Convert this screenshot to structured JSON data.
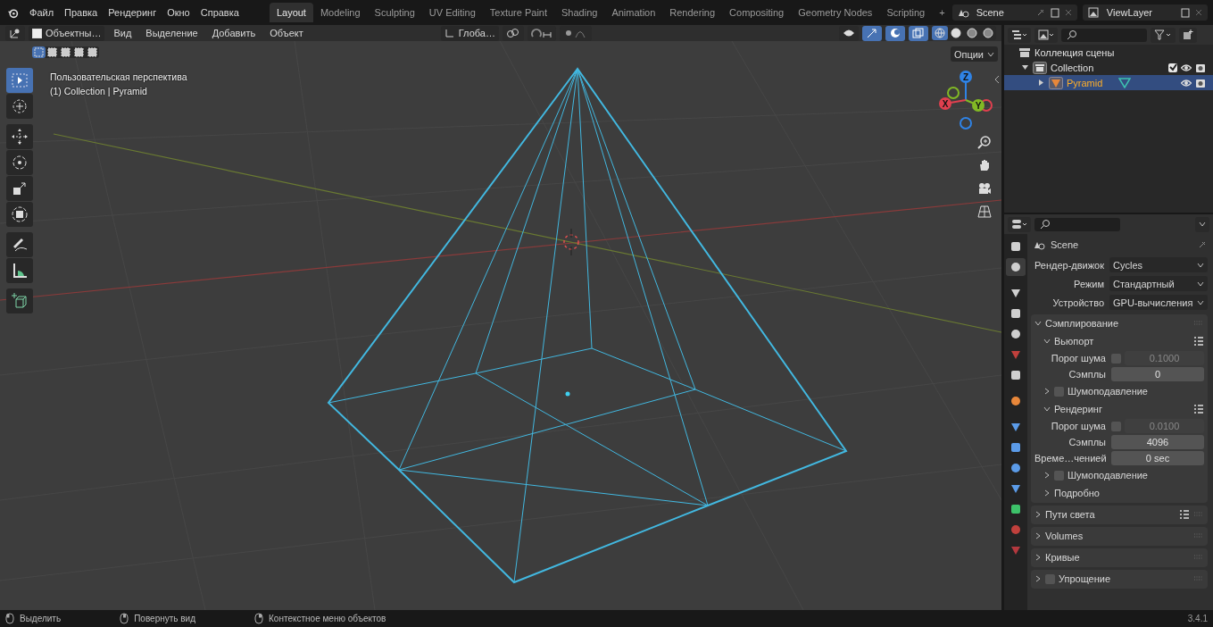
{
  "topbar": {
    "menus": [
      "Файл",
      "Правка",
      "Рендеринг",
      "Окно",
      "Справка"
    ],
    "workspaces": [
      {
        "label": "Layout",
        "selected": true
      },
      {
        "label": "Modeling",
        "selected": false
      },
      {
        "label": "Sculpting",
        "selected": false
      },
      {
        "label": "UV Editing",
        "selected": false
      },
      {
        "label": "Texture Paint",
        "selected": false
      },
      {
        "label": "Shading",
        "selected": false
      },
      {
        "label": "Animation",
        "selected": false
      },
      {
        "label": "Rendering",
        "selected": false
      },
      {
        "label": "Compositing",
        "selected": false
      },
      {
        "label": "Geometry Nodes",
        "selected": false
      },
      {
        "label": "Scripting",
        "selected": false
      }
    ],
    "add_tab": "+",
    "scene": "Scene",
    "view_layer": "ViewLayer"
  },
  "viewport": {
    "mode": "Объектны…",
    "menus": [
      "Вид",
      "Выделение",
      "Добавить",
      "Объект"
    ],
    "orientation": "Глоба…",
    "options": "Опции",
    "select_modes": [
      {
        "selected": true
      },
      {
        "selected": false
      },
      {
        "selected": false
      },
      {
        "selected": false
      },
      {
        "selected": false
      }
    ],
    "xray": true,
    "shading_modes": [
      {
        "selected": true
      },
      {
        "selected": false
      },
      {
        "selected": false
      },
      {
        "selected": false
      }
    ],
    "view_name": "Пользовательская перспектива",
    "object_info": "(1) Collection | Pyramid",
    "tools": [
      {
        "kind": "select",
        "selected": true
      },
      {
        "kind": "cursor",
        "selected": false
      },
      {
        "kind": "move",
        "selected": false
      },
      {
        "kind": "rotate",
        "selected": false
      },
      {
        "kind": "scale",
        "selected": false
      },
      {
        "kind": "transform",
        "selected": false
      },
      {
        "kind": "annotate",
        "selected": false
      },
      {
        "kind": "measure",
        "selected": false
      },
      {
        "kind": "add",
        "selected": false
      }
    ],
    "axes": [
      {
        "label": "Z",
        "color": "#2f83e6"
      },
      {
        "label": "X",
        "color": "#e0404f"
      },
      {
        "label": "Y",
        "color": "#82b925"
      }
    ]
  },
  "outliner": {
    "tree": [
      {
        "label": "Коллекция сцены",
        "children": [
          {
            "label": "Collection",
            "expanded": true,
            "checked": true,
            "selected": false,
            "children": [
              {
                "label": "Pyramid",
                "expanded": false,
                "selected": true
              }
            ]
          }
        ]
      }
    ]
  },
  "properties": {
    "tabs": [
      {
        "kind": "tool",
        "selected": false
      },
      {
        "kind": "render",
        "selected": true
      },
      {
        "kind": "output",
        "selected": false
      },
      {
        "kind": "view_layer",
        "selected": false
      },
      {
        "kind": "scene",
        "selected": false
      },
      {
        "kind": "world",
        "selected": false
      },
      {
        "kind": "collection",
        "selected": false
      },
      {
        "kind": "object",
        "selected": false
      },
      {
        "kind": "modifier",
        "selected": false
      },
      {
        "kind": "particles",
        "selected": false
      },
      {
        "kind": "physics",
        "selected": false
      },
      {
        "kind": "constraint",
        "selected": false
      },
      {
        "kind": "data",
        "selected": false
      },
      {
        "kind": "material",
        "selected": false
      },
      {
        "kind": "texture",
        "selected": false
      }
    ],
    "context": "Scene",
    "fields": [
      {
        "label": "Рендер-движок",
        "value": "Cycles"
      },
      {
        "label": "Режим",
        "value": "Стандартный"
      },
      {
        "label": "Устройство",
        "value": "GPU-вычисления"
      }
    ],
    "panels": [
      {
        "title": "Сэмплирование",
        "expanded": true,
        "children": [
          {
            "title": "Вьюпорт",
            "expanded": true,
            "rows": [
              {
                "label": "Порог шума",
                "checked": false,
                "value": "0.1000"
              },
              {
                "label": "Сэмплы",
                "value": "0"
              }
            ]
          },
          {
            "title": "Шумоподавление",
            "expanded": false,
            "checked": false
          },
          {
            "title": "Рендеринг",
            "expanded": true,
            "rows": [
              {
                "label": "Порог шума",
                "checked": false,
                "value": "0.0100"
              },
              {
                "label": "Сэмплы",
                "value": "4096"
              },
              {
                "label": "Време…ченией",
                "value": "0 sec"
              }
            ]
          },
          {
            "title": "Шумоподавление",
            "expanded": false,
            "checked": false
          },
          {
            "title": "Подробно",
            "expanded": false
          }
        ]
      },
      {
        "title": "Пути света",
        "expanded": false
      },
      {
        "title": "Volumes",
        "expanded": false
      },
      {
        "title": "Кривые",
        "expanded": false
      },
      {
        "title": "Упрощение",
        "expanded": false,
        "checked": false
      }
    ]
  },
  "status": {
    "items": [
      {
        "label": "Выделить"
      },
      {
        "label": "Повернуть вид"
      },
      {
        "label": "Контекстное меню объектов"
      }
    ],
    "version": "3.4.1"
  }
}
